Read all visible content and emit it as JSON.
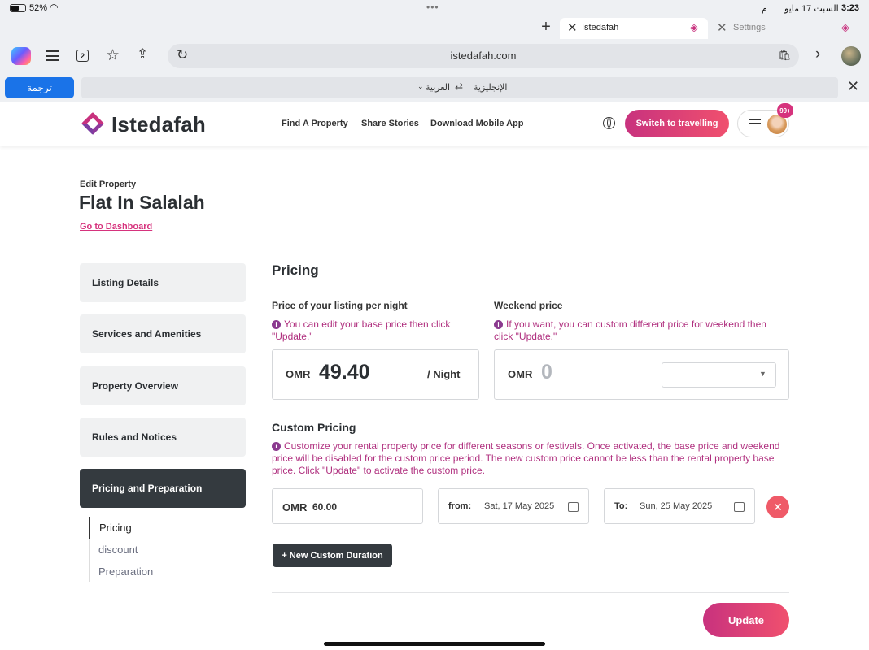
{
  "status": {
    "battery": "52%",
    "time": "3:23",
    "date": "السبت 17 مايو",
    "ampm": "م"
  },
  "browser": {
    "tabs": [
      {
        "label": "Istedafah"
      },
      {
        "label": "Settings"
      }
    ],
    "tab_count": "2",
    "url": "istedafah.com",
    "translate_button": "ترجمة",
    "lang_from": "العربية",
    "lang_to": "الإنجليزية"
  },
  "site": {
    "logo_text": "Istedafah",
    "nav": [
      "Find A Property",
      "Share Stories",
      "Download Mobile App"
    ],
    "switch_button": "Switch to travelling",
    "badge": "99+",
    "brand_color": "#c8327e"
  },
  "page": {
    "eyebrow": "Edit Property",
    "title": "Flat In Salalah",
    "dashboard_link": "Go to Dashboard"
  },
  "sidebar": {
    "items": [
      "Listing Details",
      "Services and Amenities",
      "Property Overview",
      "Rules and Notices",
      "Pricing and Preparation"
    ],
    "active_index": 4,
    "sub_items": [
      "Pricing",
      "discount",
      "Preparation"
    ]
  },
  "pricing": {
    "heading": "Pricing",
    "nightly_label": "Price of your listing per night",
    "nightly_note": "You can edit your base price then click \"Update.\"",
    "currency": "OMR",
    "nightly_value": "49.40",
    "per_night": "/ Night",
    "weekend_label": "Weekend price",
    "weekend_note": "If you want, you can custom different price for weekend then click \"Update.\"",
    "weekend_value": "0"
  },
  "custom": {
    "heading": "Custom Pricing",
    "note": "Customize your rental property price for different seasons or festivals. Once activated, the base price and weekend price will be disabled for the custom price period. The new custom price cannot be less than the rental property base price. Click \"Update\" to activate the custom price.",
    "currency": "OMR",
    "price": "60.00",
    "from_label": "from:",
    "from_date": "Sat, 17 May 2025",
    "to_label": "To:",
    "to_date": "Sun, 25 May 2025",
    "new_button": "+ New Custom Duration",
    "update_button": "Update"
  }
}
